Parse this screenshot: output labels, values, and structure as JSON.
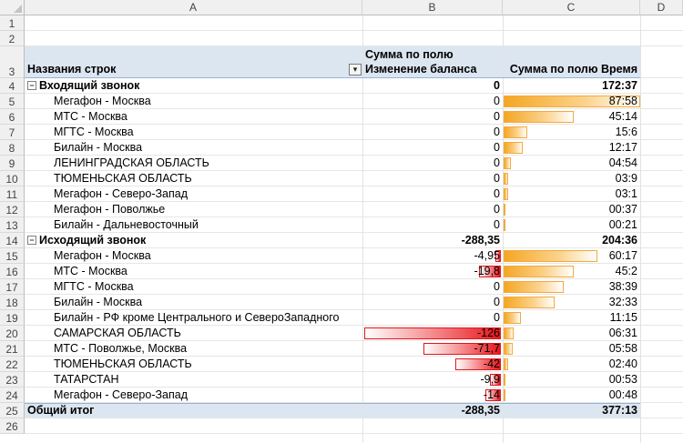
{
  "columns": [
    "A",
    "B",
    "C",
    "D"
  ],
  "rows": [
    1,
    2,
    3,
    4,
    5,
    6,
    7,
    8,
    9,
    10,
    11,
    12,
    13,
    14,
    15,
    16,
    17,
    18,
    19,
    20,
    21,
    22,
    23,
    24,
    25,
    26
  ],
  "header": {
    "row_labels": "Названия строк",
    "sum_balance_line1": "Сумма по полю",
    "sum_balance_line2": "Изменение баланса",
    "sum_time": "Сумма по полю Время",
    "filter_icon": "filter-dropdown-icon"
  },
  "groups": [
    {
      "name": "Входящий звонок",
      "toggle": "⊟",
      "balance": "0",
      "time": "172:37",
      "items": [
        {
          "name": "Мегафон - Москва",
          "balance": "0",
          "time": "87:58",
          "time_fill": 1.0,
          "balance_fill": 0
        },
        {
          "name": "МТС - Москва",
          "balance": "0",
          "time": "45:14",
          "time_fill": 0.51,
          "balance_fill": 0
        },
        {
          "name": "МГТС - Москва",
          "balance": "0",
          "time": "15:6",
          "time_fill": 0.17,
          "balance_fill": 0
        },
        {
          "name": "Билайн - Москва",
          "balance": "0",
          "time": "12:17",
          "time_fill": 0.14,
          "balance_fill": 0
        },
        {
          "name": "ЛЕНИНГРАДСКАЯ ОБЛАСТЬ",
          "balance": "0",
          "time": "04:54",
          "time_fill": 0.055,
          "balance_fill": 0
        },
        {
          "name": "ТЮМЕНЬСКАЯ ОБЛАСТЬ",
          "balance": "0",
          "time": "03:9",
          "time_fill": 0.036,
          "balance_fill": 0
        },
        {
          "name": "Мегафон - Северо-Запад",
          "balance": "0",
          "time": "03:1",
          "time_fill": 0.034,
          "balance_fill": 0
        },
        {
          "name": "Мегафон - Поволжье",
          "balance": "0",
          "time": "00:37",
          "time_fill": 0.007,
          "balance_fill": 0
        },
        {
          "name": "Билайн - Дальневосточный",
          "balance": "0",
          "time": "00:21",
          "time_fill": 0.004,
          "balance_fill": 0
        }
      ]
    },
    {
      "name": "Исходящий звонок",
      "toggle": "⊟",
      "balance": "-288,35",
      "time": "204:36",
      "items": [
        {
          "name": "Мегафон - Москва",
          "balance": "-4,95",
          "time": "60:17",
          "time_fill": 0.685,
          "balance_fill": 0.04
        },
        {
          "name": "МТС - Москва",
          "balance": "-19,8",
          "time": "45:2",
          "time_fill": 0.51,
          "balance_fill": 0.157
        },
        {
          "name": "МГТС - Москва",
          "balance": "0",
          "time": "38:39",
          "time_fill": 0.44,
          "balance_fill": 0
        },
        {
          "name": "Билайн - Москва",
          "balance": "0",
          "time": "32:33",
          "time_fill": 0.37,
          "balance_fill": 0
        },
        {
          "name": "Билайн - РФ кроме Центрального и СевероЗападного",
          "balance": "0",
          "time": "11:15",
          "time_fill": 0.128,
          "balance_fill": 0
        },
        {
          "name": "САМАРСКАЯ ОБЛАСТЬ",
          "balance": "-126",
          "time": "06:31",
          "time_fill": 0.074,
          "balance_fill": 1.0
        },
        {
          "name": "МТС - Поволжье, Москва",
          "balance": "-71,7",
          "time": "05:58",
          "time_fill": 0.068,
          "balance_fill": 0.569
        },
        {
          "name": "ТЮМЕНЬСКАЯ ОБЛАСТЬ",
          "balance": "-42",
          "time": "02:40",
          "time_fill": 0.03,
          "balance_fill": 0.333
        },
        {
          "name": "ТАТАРСТАН",
          "balance": "-9,9",
          "time": "00:53",
          "time_fill": 0.01,
          "balance_fill": 0.079
        },
        {
          "name": "Мегафон - Северо-Запад",
          "balance": "-14",
          "time": "00:48",
          "time_fill": 0.009,
          "balance_fill": 0.111
        }
      ]
    }
  ],
  "total": {
    "label": "Общий итог",
    "balance": "-288,35",
    "time": "377:13"
  },
  "colors": {
    "data_bar_positive": "#f5a623",
    "data_bar_negative": "#e8161c",
    "total_band": "#dce6f1",
    "header_band": "#dce6f1"
  }
}
